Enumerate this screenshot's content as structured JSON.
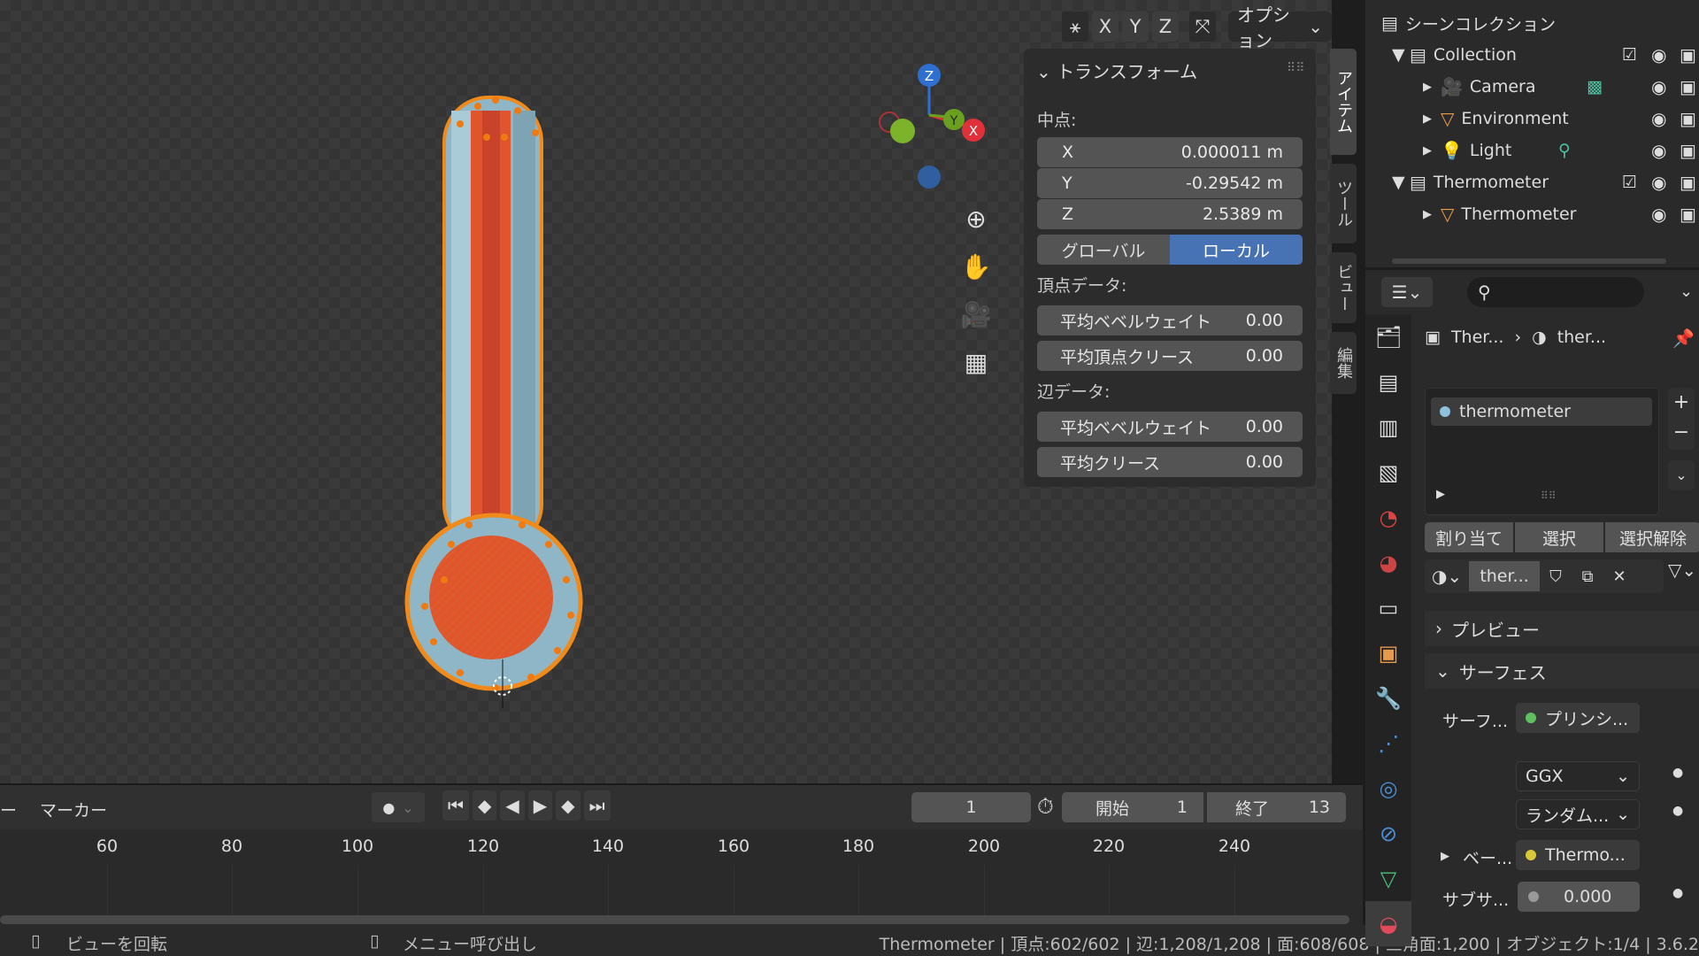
{
  "viewport": {
    "axes": [
      "X",
      "Y",
      "Z"
    ],
    "options_label": "オプション",
    "gizmo_labels": {
      "x": "X",
      "y": "Y",
      "z": "Z"
    }
  },
  "npanel": {
    "title": "トランスフォーム",
    "median_label": "中点:",
    "fields": [
      {
        "label": "X",
        "value": "0.000011 m"
      },
      {
        "label": "Y",
        "value": "-0.29542 m"
      },
      {
        "label": "Z",
        "value": "2.5389 m"
      }
    ],
    "space_global": "グローバル",
    "space_local": "ローカル",
    "vertex_data_label": "頂点データ:",
    "vertex_fields": [
      {
        "label": "平均ベベルウェイト",
        "value": "0.00"
      },
      {
        "label": "平均頂点クリース",
        "value": "0.00"
      }
    ],
    "edge_data_label": "辺データ:",
    "edge_fields": [
      {
        "label": "平均ベベルウェイト",
        "value": "0.00"
      },
      {
        "label": "平均クリース",
        "value": "0.00"
      }
    ],
    "tabs": [
      "アイテム",
      "ツール",
      "ビュー",
      "編集"
    ]
  },
  "timeline": {
    "marker_label": "マーカー",
    "current_frame": "1",
    "start_label": "開始",
    "start_value": "1",
    "end_label": "終了",
    "end_value": "13",
    "ticks": [
      "60",
      "80",
      "100",
      "120",
      "140",
      "160",
      "180",
      "200",
      "220",
      "240"
    ]
  },
  "statusbar": {
    "left1": "ビューを回転",
    "left2": "メニュー呼び出し",
    "right": "Thermometer | 頂点:602/602 | 辺:1,208/1,208 | 面:608/608 | 三角面:1,200 | オブジェクト:1/4 | 3.6.2"
  },
  "outliner": {
    "root": "シーンコレクション",
    "rows": [
      {
        "name": "Collection",
        "level": 1
      },
      {
        "name": "Camera",
        "level": 2
      },
      {
        "name": "Environment",
        "level": 2
      },
      {
        "name": "Light",
        "level": 2
      },
      {
        "name": "Thermometer",
        "level": 1
      },
      {
        "name": "Thermometer",
        "level": 2
      }
    ]
  },
  "properties": {
    "breadcrumb_object": "Ther...",
    "breadcrumb_material": "ther...",
    "material_slot": "thermometer",
    "assign": "割り当て",
    "select": "選択",
    "deselect": "選択解除",
    "material_name": "ther...",
    "preview_section": "プレビュー",
    "surface_section": "サーフェス",
    "surface_label": "サーフ...",
    "surface_value": "プリンシ...",
    "distribution": "GGX",
    "subsurface_method": "ランダム...",
    "base_label": "ベー...",
    "base_value": "Thermo...",
    "subsurface_label": "サブサ...",
    "subsurface_value": "0.000"
  }
}
